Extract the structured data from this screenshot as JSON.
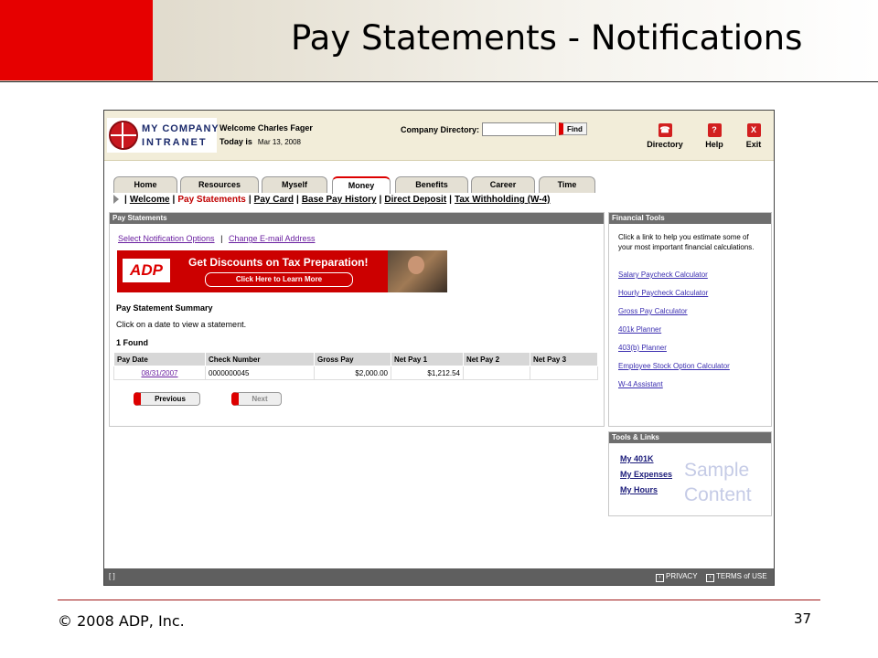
{
  "slide": {
    "title": "Pay Statements - Notifications",
    "copyright": "© 2008 ADP, Inc.",
    "page_number": "37",
    "accent_color": "#e60000"
  },
  "portal": {
    "logo": {
      "line1": "MY COMPANY",
      "line2": "INTRANET"
    },
    "welcome": "Welcome Charles Fager",
    "today_label": "Today is",
    "today_date": "Mar 13, 2008",
    "directory_label": "Company Directory:",
    "directory_value": "",
    "find_label": "Find",
    "tools": [
      {
        "label": "Directory",
        "icon": "phone-icon",
        "glyph": "☎"
      },
      {
        "label": "Help",
        "icon": "help-icon",
        "glyph": "?"
      },
      {
        "label": "Exit",
        "icon": "exit-icon",
        "glyph": "X"
      }
    ],
    "tabs": [
      "Home",
      "Resources",
      "Myself",
      "Money",
      "Benefits",
      "Career",
      "Time"
    ],
    "active_tab": "Money",
    "subnav": [
      "Welcome",
      "Pay Statements",
      "Pay Card",
      "Base Pay History",
      "Direct Deposit",
      "Tax Withholding (W-4)"
    ],
    "active_subnav": "Pay Statements"
  },
  "pay_statements": {
    "header": "Pay Statements",
    "link_options": "Select Notification Options",
    "link_separator": "|",
    "link_email": "Change E-mail Address",
    "banner": {
      "logo": "ADP",
      "title": "Get Discounts on Tax Preparation!",
      "button": "Click Here to Learn More"
    },
    "summary_title": "Pay Statement Summary",
    "summary_hint": "Click on a date to view a statement.",
    "found": "1  Found",
    "columns": [
      "Pay Date",
      "Check Number",
      "Gross Pay",
      "Net Pay 1",
      "Net Pay 2",
      "Net Pay 3"
    ],
    "rows": [
      {
        "pay_date": "08/31/2007",
        "check_number": "0000000045",
        "gross_pay": "$2,000.00",
        "net_pay_1": "$1,212.54",
        "net_pay_2": "",
        "net_pay_3": ""
      }
    ],
    "previous_label": "Previous",
    "next_label": "Next"
  },
  "financial_tools": {
    "header": "Financial Tools",
    "intro": "Click a link to help you estimate some of your most important financial calculations.",
    "links": [
      "Salary Paycheck Calculator",
      "Hourly Paycheck Calculator",
      "Gross Pay Calculator",
      "401k Planner",
      "403(b) Planner",
      "Employee Stock Option Calculator",
      "W-4 Assistant"
    ]
  },
  "tools_links": {
    "header": "Tools & Links",
    "links": [
      "My 401K",
      "My Expenses",
      "My Hours"
    ],
    "watermark_line1": "Sample",
    "watermark_line2": "Content"
  },
  "footer": {
    "left": "[ ]",
    "privacy": "PRIVACY",
    "terms": "TERMS of USE"
  }
}
